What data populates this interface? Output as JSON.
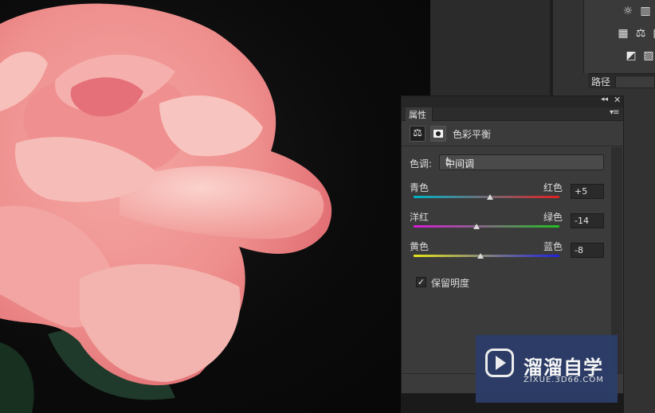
{
  "panel": {
    "tab_label": "属性",
    "collapse_glyph": "◂◂",
    "close_glyph": "✕",
    "menu_glyph": "▾≡",
    "adjustment_title": "色彩平衡",
    "tone_label": "色调:",
    "tone_value": "中间调",
    "sliders": [
      {
        "left_label": "青色",
        "right_label": "红色",
        "value": "+5",
        "numeric": 5,
        "gradient_from": "#00b4c8",
        "gradient_to": "#e02020"
      },
      {
        "left_label": "洋红",
        "right_label": "绿色",
        "value": "-14",
        "numeric": -14,
        "gradient_from": "#d81ad8",
        "gradient_to": "#20c020"
      },
      {
        "left_label": "黄色",
        "right_label": "蓝色",
        "value": "-8",
        "numeric": -8,
        "gradient_from": "#e6e61a",
        "gradient_to": "#2020e0"
      }
    ],
    "preserve_label": "保留明度",
    "preserve_checked": true
  },
  "right_dock": {
    "paths_tab": "路径",
    "icons": [
      "brightness-icon",
      "levels-icon",
      "channel-mixer-icon",
      "color-balance-icon",
      "gradient-icon",
      "selective-color-icon",
      "invert-icon",
      "gradient-map-icon"
    ]
  },
  "watermark": {
    "title": "溜溜自学",
    "url": "ZIXUE.3D66.COM"
  }
}
